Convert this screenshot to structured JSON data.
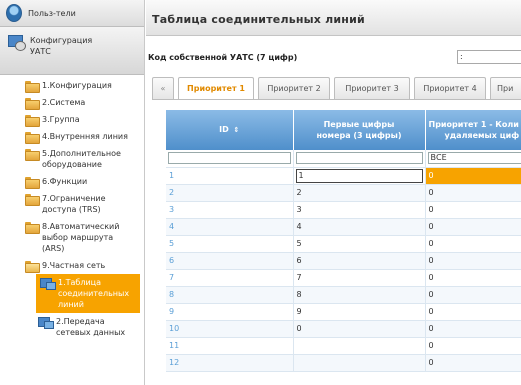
{
  "sidebar": {
    "users_label": "Польз-тели",
    "config_label_1": "Конфигурация",
    "config_label_2": "УАТС",
    "items": [
      {
        "label": "1.Конфигурация"
      },
      {
        "label": "2.Система"
      },
      {
        "label": "3.Группа"
      },
      {
        "label": "4.Внутренняя линия"
      },
      {
        "label": "5.Дополнительное оборудование"
      },
      {
        "label": "6.Функции"
      },
      {
        "label": "7.Ограничение доступа (TRS)"
      },
      {
        "label": "8.Автоматический выбор маршрута (ARS)"
      },
      {
        "label": "9.Частная сеть"
      }
    ],
    "sub_items": [
      {
        "label": "1.Таблица соединительных линий"
      },
      {
        "label": "2.Передача сетевых данных"
      }
    ]
  },
  "main": {
    "title": "Таблица соединительных линий",
    "own_code_label": "Код собственной УАТС (7 цифр)",
    "own_code_value": ":"
  },
  "tabs": {
    "prev": "«",
    "t1": "Приоритет 1",
    "t2": "Приоритет 2",
    "t3": "Приоритет 3",
    "t4": "Приоритет 4",
    "t5": "При"
  },
  "table": {
    "headers": {
      "id": "ID",
      "sort_glyph": "⇕",
      "digits_1": "Первые цифры",
      "digits_2": "номера (3 цифры)",
      "prio_1": "Приоритет 1 - Коли",
      "prio_2": "удаляемых циф"
    },
    "filter": {
      "id": "",
      "digits": "",
      "prio": "ВСЕ"
    },
    "rows": [
      {
        "id": "1",
        "digits": "1",
        "prio": "0"
      },
      {
        "id": "2",
        "digits": "2",
        "prio": "0"
      },
      {
        "id": "3",
        "digits": "3",
        "prio": "0"
      },
      {
        "id": "4",
        "digits": "4",
        "prio": "0"
      },
      {
        "id": "5",
        "digits": "5",
        "prio": "0"
      },
      {
        "id": "6",
        "digits": "6",
        "prio": "0"
      },
      {
        "id": "7",
        "digits": "7",
        "prio": "0"
      },
      {
        "id": "8",
        "digits": "8",
        "prio": "0"
      },
      {
        "id": "9",
        "digits": "9",
        "prio": "0"
      },
      {
        "id": "10",
        "digits": "0",
        "prio": "0"
      },
      {
        "id": "11",
        "digits": "",
        "prio": "0"
      },
      {
        "id": "12",
        "digits": "",
        "prio": "0"
      }
    ]
  },
  "colors": {
    "accent": "#f7a300",
    "header_blue": "#4f8fcb",
    "id_text": "#5b9fd6"
  }
}
